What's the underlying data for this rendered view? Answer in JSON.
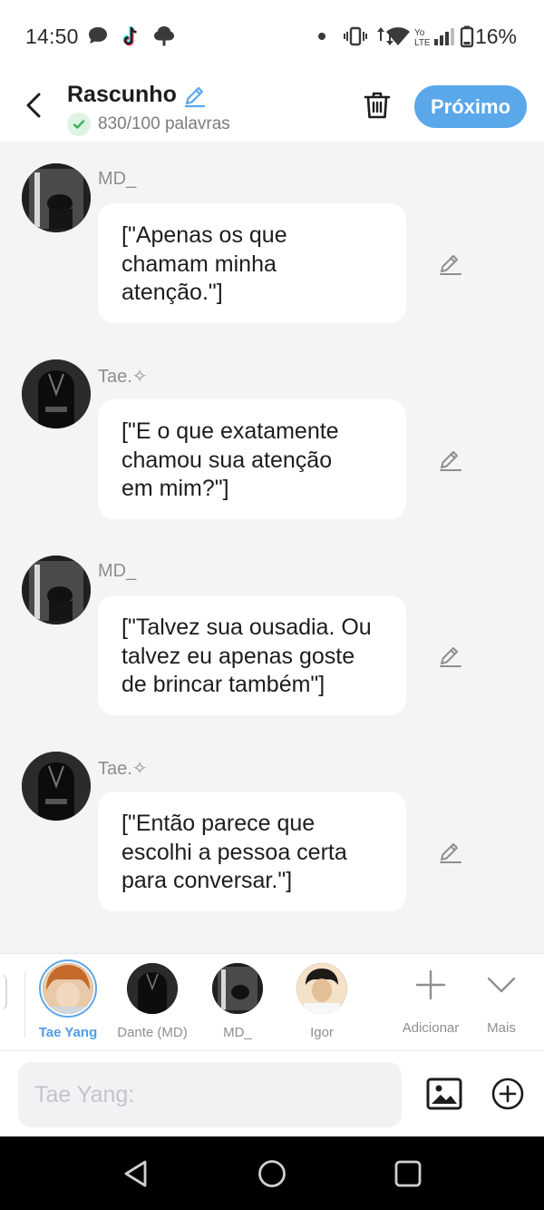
{
  "status_bar": {
    "time": "14:50",
    "battery_text": "16%",
    "icons": [
      "chat-bubble-icon",
      "tiktok-icon",
      "tree-icon",
      "dot-icon",
      "vibrate-icon",
      "data-arrows-icon",
      "wifi-icon",
      "volte-icon",
      "signal-icon",
      "battery-icon"
    ]
  },
  "header": {
    "title": "Rascunho",
    "word_count": "830/100 palavras",
    "next_label": "Próximo"
  },
  "messages": [
    {
      "sender": "MD_",
      "line1": "[\"Apenas os que",
      "line2": "chamam minha",
      "line3": "atenção.\"]"
    },
    {
      "sender": "Tae.✧",
      "line1": "[\"E o que exatamente",
      "line2": "chamou sua atenção",
      "line3": "em mim?\"]"
    },
    {
      "sender": "MD_",
      "line1": "[\"Talvez sua ousadia. Ou",
      "line2": "talvez eu apenas goste",
      "line3": "de brincar também\"]"
    },
    {
      "sender": "Tae.✧",
      "line1": "[\"Então parece que",
      "line2": "escolhi a pessoa certa",
      "line3": "para conversar.\"]"
    }
  ],
  "characters": [
    {
      "name": "Tae Yang",
      "selected": true
    },
    {
      "name": "Dante (MD)",
      "selected": false
    },
    {
      "name": "MD_",
      "selected": false
    },
    {
      "name": "Igor",
      "selected": false
    }
  ],
  "char_actions": {
    "add_label": "Adicionar",
    "more_label": "Mais"
  },
  "composer": {
    "placeholder": "Tae Yang:"
  },
  "colors": {
    "accent": "#5aa7ea",
    "active_name": "#4e9de6",
    "background": "#f4f4f5",
    "bubble": "#ffffff",
    "muted_text": "#8e8e93"
  }
}
